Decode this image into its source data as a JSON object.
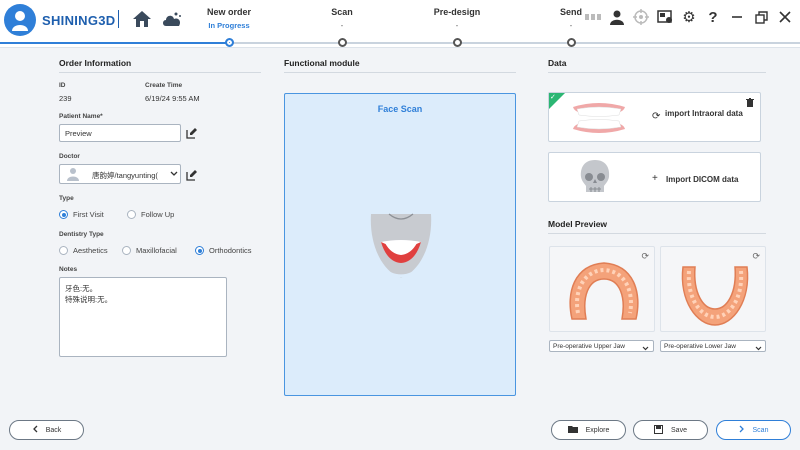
{
  "app": {
    "brand": "SHINING3D"
  },
  "steps": [
    {
      "name": "New order",
      "status": "In Progress"
    },
    {
      "name": "Scan",
      "status": "-"
    },
    {
      "name": "Pre-design",
      "status": "-"
    },
    {
      "name": "Send",
      "status": "-"
    }
  ],
  "order": {
    "title": "Order Information",
    "id_label": "ID",
    "id_value": "239",
    "create_label": "Create Time",
    "create_value": "6/19/24 9:55 AM",
    "patient_label": "Patient Name*",
    "patient_value": "Preview",
    "doctor_label": "Doctor",
    "doctor_value": "唐韵婷/tangyunting(",
    "type_label": "Type",
    "type_options": [
      "First Visit",
      "Follow Up"
    ],
    "dentistry_label": "Dentistry Type",
    "dentistry_options": [
      "Aesthetics",
      "Maxillofacial",
      "Orthodontics"
    ],
    "notes_label": "Notes",
    "notes_value": "牙色:无。\n特殊说明:无。"
  },
  "module": {
    "title": "Functional module",
    "face_scan": "Face Scan"
  },
  "data": {
    "title": "Data",
    "intraoral": "import Intraoral data",
    "dicom": "Import DICOM data",
    "preview_title": "Model Preview",
    "upper_select": "Pre-operative Upper Jaw",
    "lower_select": "Pre-operative Lower Jaw"
  },
  "footer": {
    "back": "Back",
    "explore": "Explore",
    "save": "Save",
    "scan": "Scan"
  },
  "colors": {
    "accent": "#2f7fd8",
    "brand": "#1e5fae",
    "panel": "#dcecfb",
    "badge": "#2bb673"
  }
}
